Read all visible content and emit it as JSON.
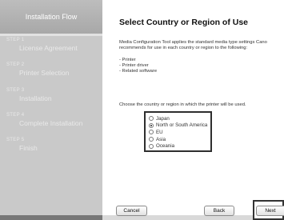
{
  "sidebar": {
    "header": "Installation Flow",
    "steps": [
      {
        "num": "STEP 1",
        "label": "License Agreement"
      },
      {
        "num": "STEP 2",
        "label": "Printer Selection"
      },
      {
        "num": "STEP 3",
        "label": "Installation"
      },
      {
        "num": "STEP 4",
        "label": "Complete Installation"
      },
      {
        "num": "STEP 5",
        "label": "Finish"
      }
    ]
  },
  "main": {
    "title": "Select Country or Region of Use",
    "description": [
      "Media Configuration Tool applies the standard media type settings Cano",
      "recommends for use in each country or region to the following:"
    ],
    "bullets": [
      "- Printer",
      "- Printer driver",
      "- Related software"
    ],
    "prompt": "Choose the country or region in which the printer will be used.",
    "region_options": [
      {
        "label": "Japan",
        "checked": false
      },
      {
        "label": "North or South America",
        "checked": true
      },
      {
        "label": "EU",
        "checked": false
      },
      {
        "label": "Asia",
        "checked": false
      },
      {
        "label": "Oceania",
        "checked": false
      }
    ]
  },
  "footer": {
    "cancel_label": "Cancel",
    "back_label": "Back",
    "next_label": "Next"
  }
}
